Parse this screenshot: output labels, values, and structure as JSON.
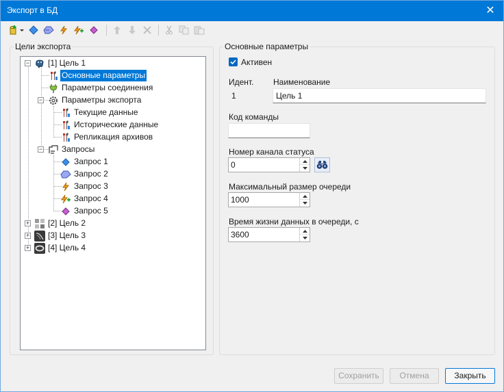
{
  "window": {
    "title": "Экспорт в БД",
    "close_glyph": "✕"
  },
  "toolbar": {
    "buttons": [
      {
        "icon": "add-target-icon"
      },
      {
        "icon": "add-query-1-icon"
      },
      {
        "icon": "add-query-2-icon"
      },
      {
        "icon": "add-query-3-icon"
      },
      {
        "icon": "add-query-4-icon"
      },
      {
        "icon": "add-query-5-icon"
      },
      {
        "icon": "move-up-icon"
      },
      {
        "icon": "move-down-icon"
      },
      {
        "icon": "delete-icon"
      },
      {
        "icon": "cut-icon"
      },
      {
        "icon": "copy-icon"
      },
      {
        "icon": "paste-icon"
      }
    ]
  },
  "left_panel": {
    "title": "Цели экспорта"
  },
  "tree": {
    "target1": "[1] Цель 1",
    "basic_params": "Основные параметры",
    "conn_params": "Параметры соединения",
    "export_params": "Параметры экспорта",
    "current_data": "Текущие данные",
    "historical_data": "Исторические данные",
    "archive_replication": "Репликация архивов",
    "queries": "Запросы",
    "query1": "Запрос 1",
    "query2": "Запрос 2",
    "query3": "Запрос 3",
    "query4": "Запрос 4",
    "query5": "Запрос 5",
    "target2": "[2] Цель 2",
    "target3": "[3] Цель 3",
    "target4": "[4] Цель 4",
    "expand_glyph": "+",
    "collapse_glyph": "−"
  },
  "right_panel": {
    "title": "Основные параметры",
    "active_label": "Активен",
    "active_checked": true,
    "id_label": "Идент.",
    "id_value": "1",
    "name_label": "Наименование",
    "name_value": "Цель 1",
    "command_code_label": "Код команды",
    "command_code_value": "",
    "status_channel_label": "Номер канала статуса",
    "status_channel_value": "0",
    "max_queue_label": "Максимальный размер очереди",
    "max_queue_value": "1000",
    "lifetime_label": "Время жизни данных в очереди, с",
    "lifetime_value": "3600"
  },
  "footer": {
    "save_label": "Сохранить",
    "cancel_label": "Отмена",
    "close_label": "Закрыть"
  },
  "colors": {
    "accent": "#0078d7",
    "selection": "#0078d7",
    "checkbox": "#0067c0"
  }
}
